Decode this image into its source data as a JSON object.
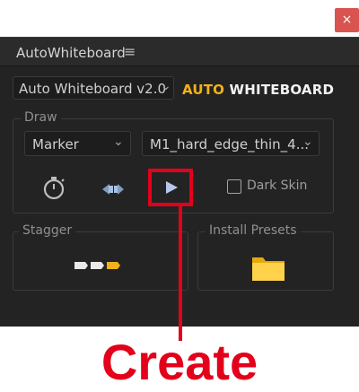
{
  "window": {
    "close_label": "×"
  },
  "panel": {
    "title": "AutoWhiteboard",
    "menu_icon": "≡",
    "version_select": "Auto Whiteboard v2.0",
    "chevron": "⌄",
    "logo": {
      "part1": "AUTO",
      "part2": " WHITEBOARD"
    }
  },
  "draw": {
    "label": "Draw",
    "tool_select": "Marker",
    "preset_select": "M1_hard_edge_thin_4...",
    "dark_skin_label": "Dark Skin",
    "dark_skin_checked": false
  },
  "stagger": {
    "label": "Stagger"
  },
  "install": {
    "label": "Install Presets"
  },
  "annotation": {
    "label": "Create"
  },
  "colors": {
    "accent": "#f1b11c",
    "highlight": "#e3001b",
    "panel_bg": "#232323"
  },
  "icons": {
    "close": "close-icon",
    "menu": "hamburger-menu-icon",
    "timer": "timer-icon",
    "swap": "swap-icon",
    "play": "play-icon",
    "stagger": "stagger-icon",
    "folder": "folder-icon"
  }
}
